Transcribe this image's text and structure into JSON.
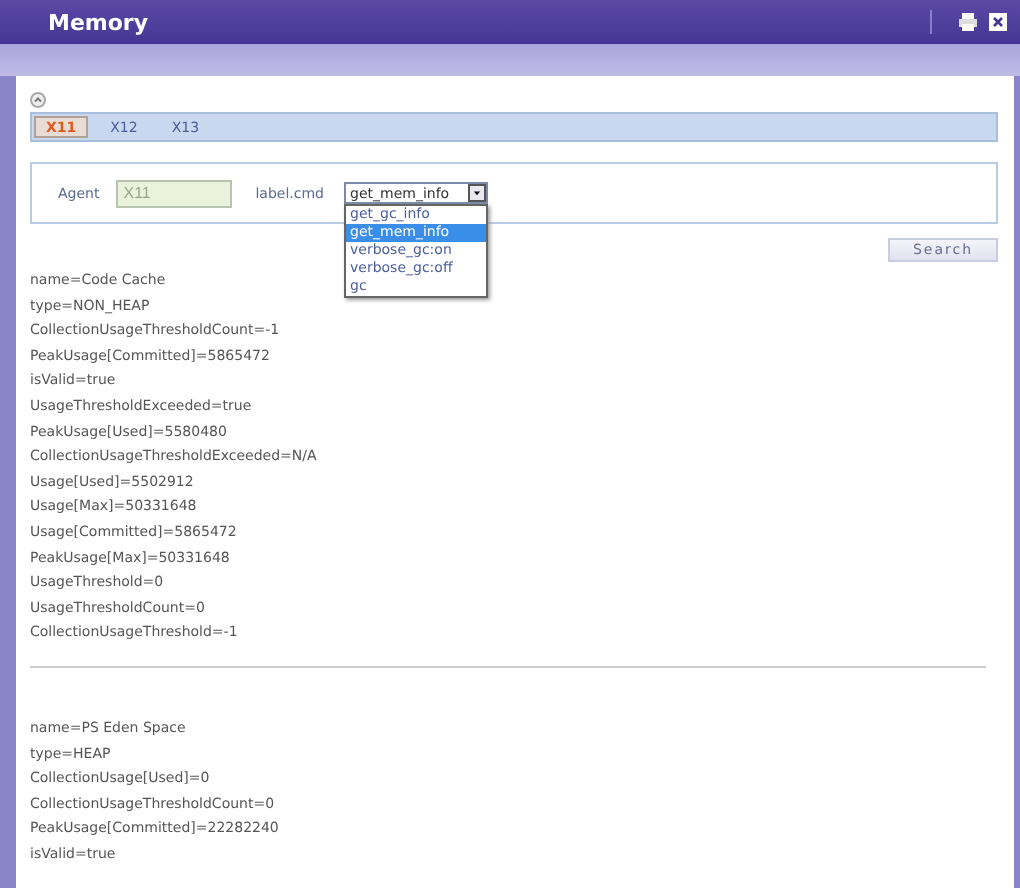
{
  "window": {
    "title": "Memory"
  },
  "tabs": [
    {
      "label": "X11",
      "selected": true
    },
    {
      "label": "X12",
      "selected": false
    },
    {
      "label": "X13",
      "selected": false
    }
  ],
  "agent": {
    "label": "Agent",
    "value": "X11"
  },
  "cmd": {
    "label": "label.cmd",
    "value": "get_mem_info",
    "expanded": true,
    "options": [
      {
        "label": "get_gc_info",
        "selected": false
      },
      {
        "label": "get_mem_info",
        "selected": true
      },
      {
        "label": "verbose_gc:on",
        "selected": false
      },
      {
        "label": "verbose_gc:off",
        "selected": false
      },
      {
        "label": "gc",
        "selected": false
      }
    ]
  },
  "search_button": "Search",
  "sections": [
    {
      "lines": [
        "name=Code Cache",
        "type=NON_HEAP",
        "CollectionUsageThresholdCount=-1",
        "PeakUsage[Committed]=5865472",
        "isValid=true",
        "UsageThresholdExceeded=true",
        "PeakUsage[Used]=5580480",
        "CollectionUsageThresholdExceeded=N/A",
        "Usage[Used]=5502912",
        "Usage[Max]=50331648",
        "Usage[Committed]=5865472",
        "PeakUsage[Max]=50331648",
        "UsageThreshold=0",
        "UsageThresholdCount=0",
        "CollectionUsageThreshold=-1"
      ]
    },
    {
      "lines": [
        "name=PS Eden Space",
        "type=HEAP",
        "CollectionUsage[Used]=0",
        "CollectionUsageThresholdCount=0",
        "PeakUsage[Committed]=22282240",
        "isValid=true"
      ]
    }
  ]
}
